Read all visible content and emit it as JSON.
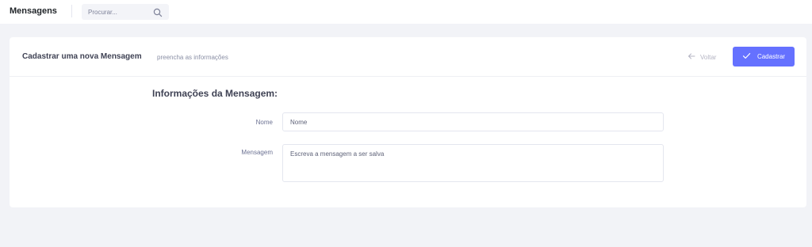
{
  "topbar": {
    "title": "Mensagens",
    "search_placeholder": "Procurar..."
  },
  "card": {
    "title": "Cadastrar uma nova Mensagem",
    "subtitle": "preencha as informações",
    "back_label": "Voltar",
    "save_label": "Cadastrar"
  },
  "form": {
    "section_title": "Informações da Mensagem:",
    "nome": {
      "label": "Nome",
      "value": "",
      "placeholder": "Nome"
    },
    "mensagem": {
      "label": "Mensagem",
      "value": "",
      "placeholder": "Escreva a mensagem a ser salva"
    }
  },
  "colors": {
    "accent": "#6571ff",
    "background": "#f2f3f7"
  },
  "icons": [
    "search-icon",
    "arrow-left-icon",
    "check-icon"
  ]
}
